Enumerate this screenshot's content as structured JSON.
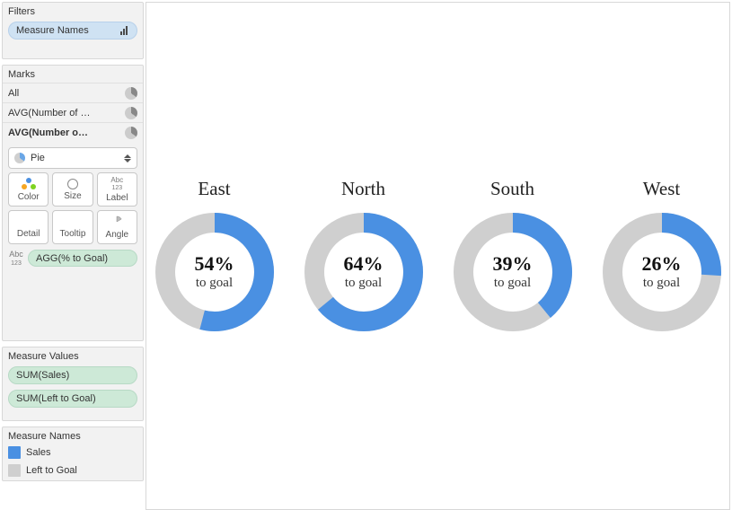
{
  "colors": {
    "accent": "#4a90e2",
    "grey": "#cfcfcf",
    "pill_blue": "#cfe2f3",
    "pill_green": "#cde9d7"
  },
  "filters": {
    "title": "Filters",
    "items": [
      {
        "label": "Measure Names",
        "type": "blue"
      }
    ]
  },
  "marks": {
    "title": "Marks",
    "rows": [
      {
        "label": "All",
        "bold": false
      },
      {
        "label": "AVG(Number of …",
        "bold": false
      },
      {
        "label": "AVG(Number o…",
        "bold": true
      }
    ],
    "mark_type": "Pie",
    "buttons": [
      {
        "id": "color",
        "label": "Color"
      },
      {
        "id": "size",
        "label": "Size"
      },
      {
        "id": "label",
        "label": "Label"
      },
      {
        "id": "detail",
        "label": "Detail"
      },
      {
        "id": "tooltip",
        "label": "Tooltip"
      },
      {
        "id": "angle",
        "label": "Angle"
      }
    ],
    "shelf_pill": {
      "icon": "label",
      "label": "AGG(% to Goal)"
    }
  },
  "measure_values": {
    "title": "Measure Values",
    "items": [
      {
        "label": "SUM(Sales)"
      },
      {
        "label": "SUM(Left to Goal)"
      }
    ]
  },
  "measure_names": {
    "title": "Measure Names",
    "legend": [
      {
        "swatch": "#4a90e2",
        "label": "Sales"
      },
      {
        "swatch": "#cfcfcf",
        "label": "Left to Goal"
      }
    ]
  },
  "chart_data": {
    "type": "pie",
    "title": "",
    "subtitle_suffix": "to goal",
    "series": [
      {
        "name": "Sales",
        "color": "#4a90e2"
      },
      {
        "name": "Left to Goal",
        "color": "#cfcfcf"
      }
    ],
    "categories": [
      "East",
      "North",
      "South",
      "West"
    ],
    "values_pct_to_goal": [
      54,
      64,
      39,
      26
    ],
    "slices": [
      {
        "category": "East",
        "Sales": 54,
        "Left to Goal": 46
      },
      {
        "category": "North",
        "Sales": 64,
        "Left to Goal": 36
      },
      {
        "category": "South",
        "Sales": 39,
        "Left to Goal": 61
      },
      {
        "category": "West",
        "Sales": 26,
        "Left to Goal": 74
      }
    ]
  }
}
